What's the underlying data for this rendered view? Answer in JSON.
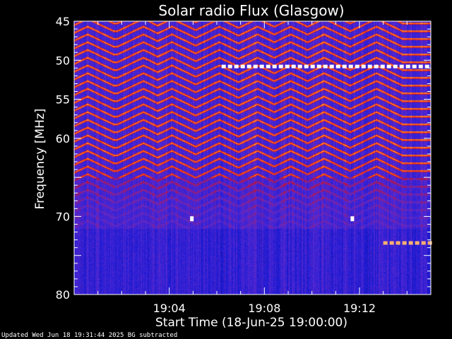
{
  "chart_data": {
    "type": "heatmap",
    "title": "Solar radio Flux (Glasgow)",
    "xlabel": "Start Time (18-Jun-25 19:00:00)",
    "ylabel": "Frequency [MHz]",
    "x_unit": "minutes after 19:00:00",
    "x_range": [
      0,
      15
    ],
    "x_ticks": [
      {
        "value": 4,
        "label": "19:04"
      },
      {
        "value": 8,
        "label": "19:08"
      },
      {
        "value": 12,
        "label": "19:12"
      }
    ],
    "y_range": [
      45,
      80
    ],
    "y_scale": "linear",
    "y_ticks": [
      45,
      50,
      55,
      60,
      65,
      70,
      75,
      80
    ],
    "y_tick_labels": [
      "45",
      "50",
      "55",
      "60",
      "",
      "70",
      "",
      "80"
    ],
    "y_inverted": true,
    "colormap": [
      "#0a0a6e",
      "#1a1ad6",
      "#5a2ad0",
      "#c8102a",
      "#ff3a00",
      "#ff9a3a",
      "#ffffff"
    ],
    "background": "#000000",
    "features": [
      {
        "type": "interference_band",
        "freq_mhz": 50.8,
        "x_range": [
          6.2,
          15
        ],
        "intensity": "saturated"
      },
      {
        "type": "interference_band",
        "freq_mhz": 73.4,
        "x_range": [
          13,
          15
        ],
        "intensity": "high"
      },
      {
        "type": "spot",
        "freq_mhz": 70.3,
        "x": 4.95,
        "intensity": "saturated"
      },
      {
        "type": "spot",
        "freq_mhz": 70.3,
        "x": 11.7,
        "intensity": "saturated"
      }
    ]
  },
  "footer": "Updated Wed Jun 18 19:31:44 2025   BG subtracted"
}
